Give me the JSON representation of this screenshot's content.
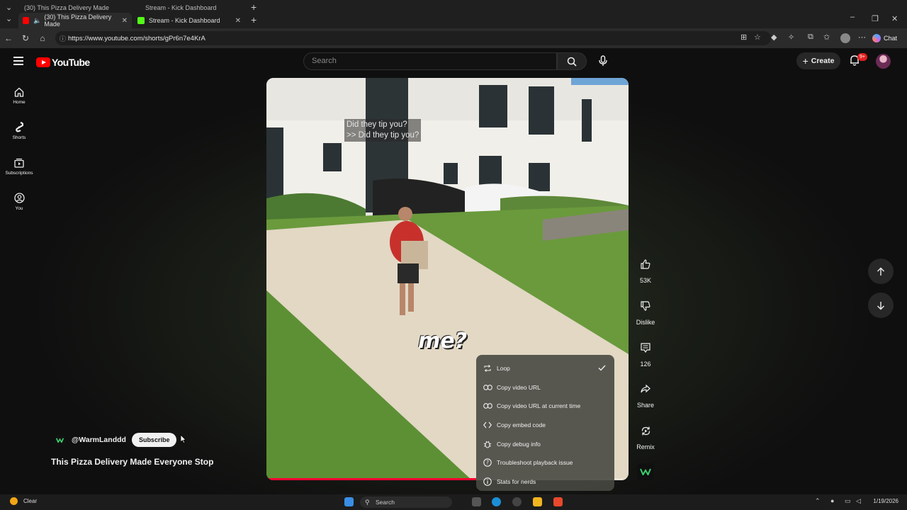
{
  "browser": {
    "tabs": [
      {
        "label": "(30) This Pizza Delivery Made",
        "active": true
      },
      {
        "label": "Stream - Kick Dashboard",
        "active": false
      }
    ],
    "ghost_tabs": [
      {
        "label": "(30) This Pizza Delivery Made"
      },
      {
        "label": "Stream - Kick Dashboard"
      }
    ],
    "url": "https://www.youtube.com/shorts/gPr6n7e4KrA",
    "chat_label": "Chat"
  },
  "header": {
    "logo_text": "YouTube",
    "search_placeholder": "Search",
    "create_label": "Create",
    "notification_badge": "9+"
  },
  "sidebar": {
    "items": [
      {
        "label": "Home",
        "icon": "home-icon"
      },
      {
        "label": "Shorts",
        "icon": "shorts-icon"
      },
      {
        "label": "Subscriptions",
        "icon": "subscriptions-icon"
      },
      {
        "label": "You",
        "icon": "you-icon"
      }
    ]
  },
  "video": {
    "caption_line1": "Did they tip you?",
    "caption_line2": ">> Did they tip you?",
    "overlay_text": "me?",
    "progress_fraction": 0.58
  },
  "context_menu": {
    "items": [
      {
        "label": "Loop",
        "icon": "loop-icon",
        "checked": true
      },
      {
        "label": "Copy video URL",
        "icon": "link-icon"
      },
      {
        "label": "Copy video URL at current time",
        "icon": "link-icon"
      },
      {
        "label": "Copy embed code",
        "icon": "code-icon"
      },
      {
        "label": "Copy debug info",
        "icon": "bug-icon"
      },
      {
        "label": "Troubleshoot playback issue",
        "icon": "help-icon"
      },
      {
        "label": "Stats for nerds",
        "icon": "info-icon"
      }
    ]
  },
  "actions": {
    "like_count": "53K",
    "dislike_label": "Dislike",
    "comment_count": "126",
    "share_label": "Share",
    "remix_label": "Remix"
  },
  "channel": {
    "name": "@WarmLanddd",
    "subscribe_label": "Subscribe"
  },
  "short_title": "This Pizza Delivery Made Everyone Stop",
  "taskbar": {
    "weather": "Clear",
    "search_label": "Search",
    "date": "1/19/2026"
  }
}
